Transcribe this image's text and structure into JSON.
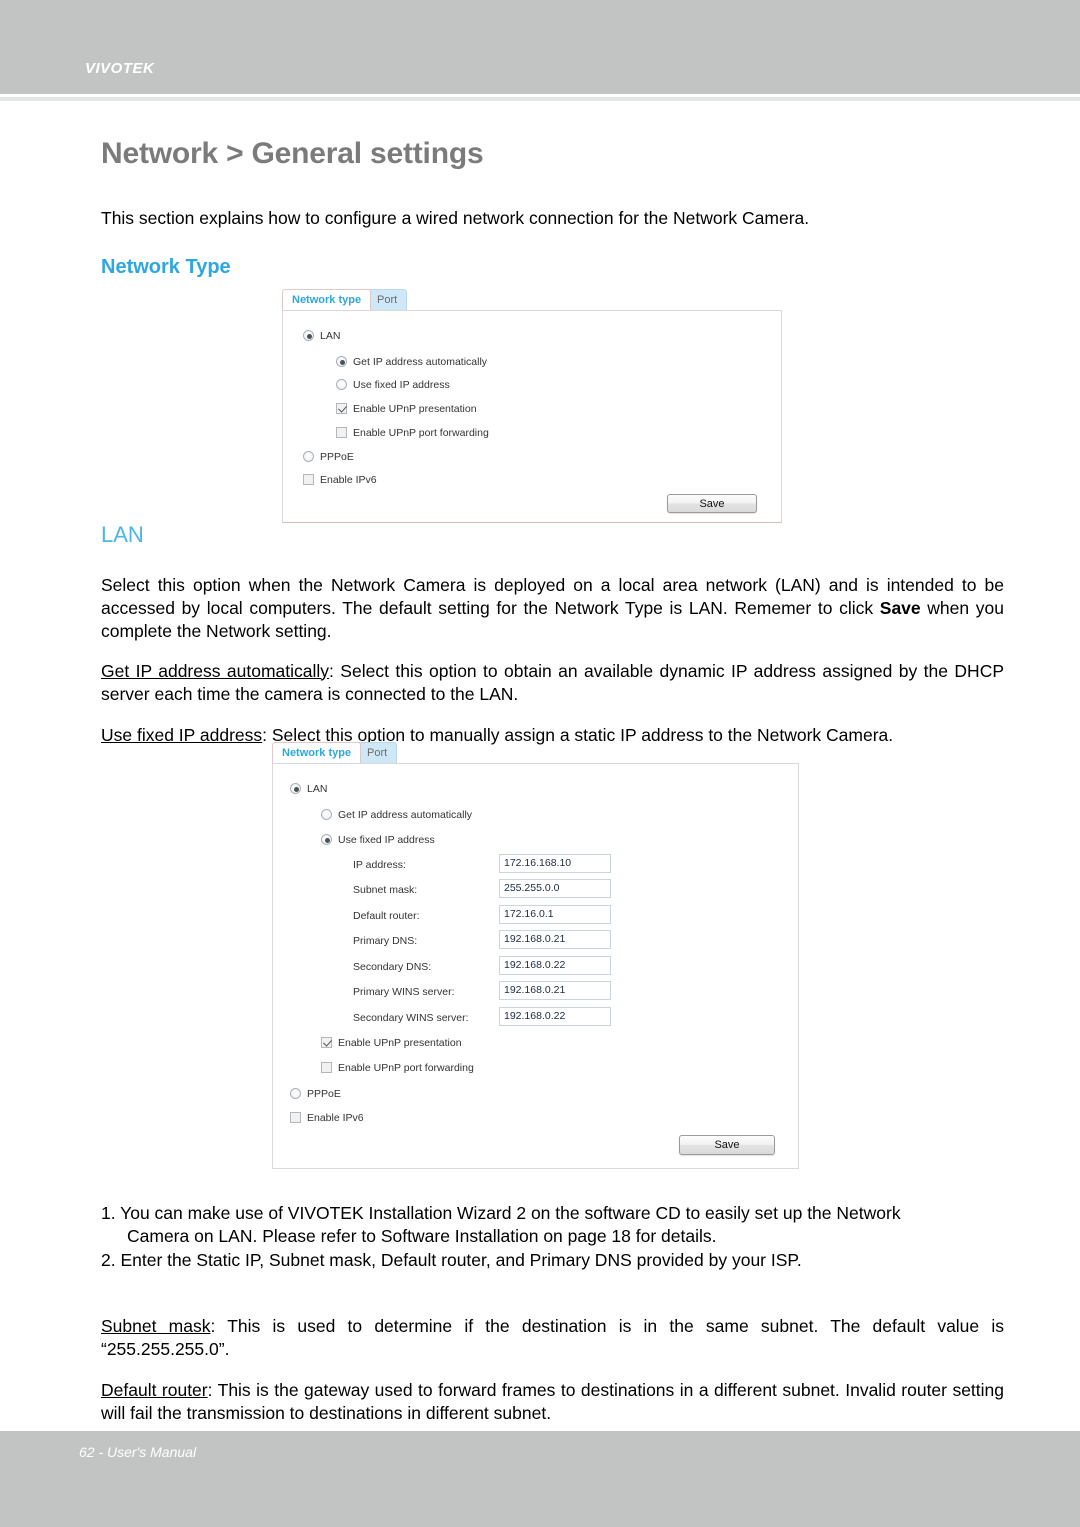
{
  "header": {
    "brand": "VIVOTEK"
  },
  "footer": {
    "text": "62 - User's Manual"
  },
  "document": {
    "title": "Network > General settings",
    "intro": "This section explains how to configure a wired network connection for the Network Camera.",
    "section_network_type": "Network Type",
    "section_lan": "LAN",
    "para_lan_a": "Select this option when the Network Camera is deployed on a local area network (LAN) and is intended to be accessed by local computers. The default setting for the Network Type is LAN. Rememer to click ",
    "para_lan_save": "Save",
    "para_lan_b": " when you complete the Network setting.",
    "para_getip_term": "Get IP address automatically",
    "para_getip_body": ": Select this option to obtain an available dynamic IP address assigned by the DHCP server each time the camera is connected to the LAN.",
    "para_usefixed_term": "Use fixed IP address",
    "para_usefixed_body": ": Select this option to manually assign a static IP address to the Network Camera.",
    "step_1": "1. You can make use of VIVOTEK Installation Wizard 2 on the software CD to easily set up the Network",
    "step_1_cont": "Camera on LAN. Please refer to Software Installation on page 18 for details.",
    "step_2": "2. Enter the Static IP, Subnet mask, Default router, and Primary DNS provided by your ISP.",
    "para_subnet_term": "Subnet mask",
    "para_subnet_body": ": This is used to determine if the destination is in the same subnet. The default value is “255.255.255.0”.",
    "para_router_term": "Default router",
    "para_router_body": ": This is the gateway used to forward frames to destinations in a different subnet. Invalid router setting will fail the transmission to destinations in different subnet."
  },
  "widget_1": {
    "tabs": [
      {
        "label": "Network type",
        "active": true
      },
      {
        "label": "Port",
        "active": false
      }
    ],
    "options": {
      "lan": "LAN",
      "get_ip_auto": "Get IP address automatically",
      "use_fixed_ip": "Use fixed IP address",
      "upnp_presentation": "Enable UPnP presentation",
      "upnp_port_forwarding": "Enable UPnP port forwarding",
      "pppoe": "PPPoE",
      "enable_ipv6": "Enable IPv6"
    },
    "save_label": "Save"
  },
  "widget_2": {
    "tabs": [
      {
        "label": "Network type",
        "active": true
      },
      {
        "label": "Port",
        "active": false
      }
    ],
    "options": {
      "lan": "LAN",
      "get_ip_auto": "Get IP address automatically",
      "use_fixed_ip": "Use fixed IP address",
      "upnp_presentation": "Enable UPnP presentation",
      "upnp_port_forwarding": "Enable UPnP port forwarding",
      "pppoe": "PPPoE",
      "enable_ipv6": "Enable IPv6"
    },
    "fields": [
      {
        "label": "IP address:",
        "value": "172.16.168.10"
      },
      {
        "label": "Subnet mask:",
        "value": "255.255.0.0"
      },
      {
        "label": "Default router:",
        "value": "172.16.0.1"
      },
      {
        "label": "Primary DNS:",
        "value": "192.168.0.21"
      },
      {
        "label": "Secondary DNS:",
        "value": "192.168.0.22"
      },
      {
        "label": "Primary WINS server:",
        "value": "192.168.0.21"
      },
      {
        "label": "Secondary WINS server:",
        "value": "192.168.0.22"
      }
    ],
    "save_label": "Save"
  },
  "colors": {
    "header_band": "#c2c4c4",
    "heading_gray": "#7b7b7b",
    "accent_blue": "#2ea7e0",
    "subheading_blue": "#4cb6e6",
    "tab_inactive_bg": "#cfe8f7"
  }
}
